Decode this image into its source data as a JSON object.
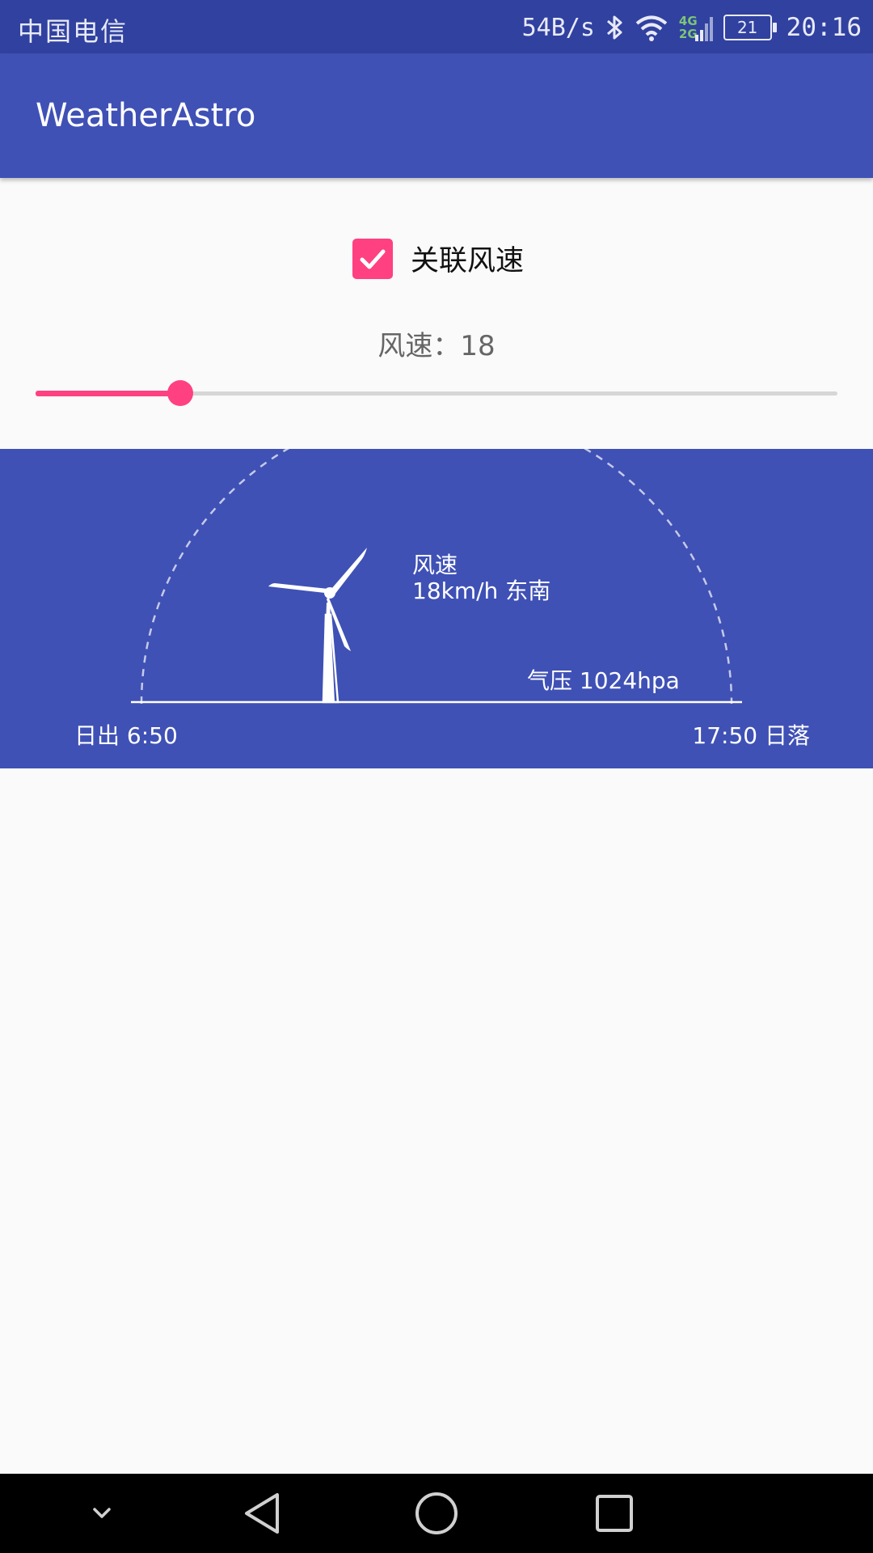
{
  "status_bar": {
    "carrier": "中国电信",
    "net_speed": "54B/s",
    "net_type_top": "4G",
    "net_type_bottom": "2G",
    "battery": "21",
    "time": "20:16"
  },
  "app_bar": {
    "title": "WeatherAstro"
  },
  "controls": {
    "link_wind_label": "关联风速",
    "link_wind_checked": true,
    "wind_speed_label": "风速：18",
    "slider_value": 18,
    "slider_max": 100
  },
  "weather": {
    "wind_title": "风速",
    "wind_value": "18km/h 东南",
    "pressure": "气压 1024hpa",
    "sunrise": "日出 6:50",
    "sunset": "17:50 日落"
  },
  "colors": {
    "primary": "#3f51b5",
    "primary_dark": "#3141a0",
    "accent": "#ff4081"
  },
  "nav_bar": {
    "icons": [
      "collapse-icon",
      "back-icon",
      "home-icon",
      "recents-icon"
    ]
  }
}
